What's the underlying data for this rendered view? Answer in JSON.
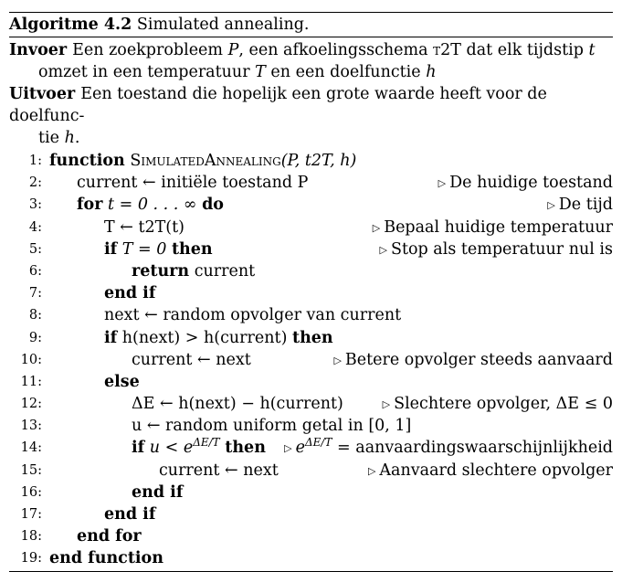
{
  "caption": {
    "label": "Algoritme 4.2",
    "title": "Simulated annealing."
  },
  "input": {
    "key": "Invoer",
    "line1a": "Een zoekprobleem",
    "P": "P",
    "line1b": ", een afkoelingsschema",
    "t2t": "t2T",
    "line1c": "dat elk tijdstip",
    "t": "t",
    "line2a": "omzet in een temperatuur",
    "T": "T",
    "line2b": "en een doelfunctie",
    "h": "h"
  },
  "output": {
    "key": "Uitvoer",
    "line1": "Een toestand die hopelijk een grote waarde heeft voor de doelfunc-",
    "line2a": "tie",
    "h": "h",
    "line2b": "."
  },
  "lines": [
    {
      "n": "1:"
    },
    {
      "n": "2:"
    },
    {
      "n": "3:"
    },
    {
      "n": "4:"
    },
    {
      "n": "5:"
    },
    {
      "n": "6:"
    },
    {
      "n": "7:"
    },
    {
      "n": "8:"
    },
    {
      "n": "9:"
    },
    {
      "n": "10:"
    },
    {
      "n": "11:"
    },
    {
      "n": "12:"
    },
    {
      "n": "13:"
    },
    {
      "n": "14:"
    },
    {
      "n": "15:"
    },
    {
      "n": "16:"
    },
    {
      "n": "17:"
    },
    {
      "n": "18:"
    },
    {
      "n": "19:"
    }
  ],
  "kw": {
    "function": "function",
    "for": "for",
    "do": "do",
    "if": "if",
    "then": "then",
    "return": "return",
    "end_if": "end if",
    "else": "else",
    "end_for": "end for",
    "end_function": "end function"
  },
  "code": {
    "l1_name": "SimulatedAnnealing",
    "l1_args": "(P, t2T, h)",
    "l2": "current ← initiële toestand P",
    "l3_mid": "t = 0 . . . ∞",
    "l4": "T ← t2T(t)",
    "l5_mid": "T = 0",
    "l6": "current",
    "l8": "next ← random opvolger van current",
    "l9_mid": "h(next) > h(current)",
    "l10": "current ← next",
    "l12": "ΔE ← h(next) − h(current)",
    "l13": "u ← random uniform getal in [0, 1]",
    "l14_mid_a": "u < e",
    "l14_mid_sup": "ΔE/T",
    "l15": "current ← next"
  },
  "comments": {
    "c2": "De huidige toestand",
    "c3": "De tijd",
    "c4": "Bepaal huidige temperatuur",
    "c5": "Stop als temperatuur nul is",
    "c10": "Betere opvolger steeds aanvaard",
    "c12": "Slechtere opvolger, ΔE ≤ 0",
    "c14_a": "e",
    "c14_sup": "ΔE/T",
    "c14_b": "= aanvaardingswaarschijnlijkheid",
    "c15": "Aanvaard slechtere opvolger"
  },
  "comment_marker": "▷"
}
